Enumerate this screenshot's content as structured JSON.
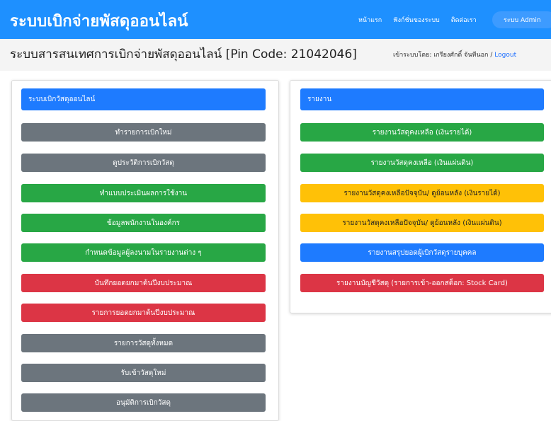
{
  "navbar": {
    "brand": "ระบบเบิกจ่ายพัสดุออนไลน์",
    "links": [
      "หน้าแรก",
      "ฟังก์ชั่นของระบบ",
      "ติดต่อเรา"
    ],
    "admin_button": "ระบบ Admin"
  },
  "subheader": {
    "title": "ระบบสารสนเทศการเบิกจ่ายพัสดุออนไลน์ [Pin Code: 21042046]",
    "login_label": "เข้าระบบโดย: เกรียงศักดิ์ จันทีนอก",
    "separator": "/",
    "logout": "Logout"
  },
  "left_panel": {
    "heading": "ระบบเบิกวัสดุออนไลน์",
    "buttons": [
      {
        "label": "ทำรายการเบิกใหม่",
        "color": "#6c757d"
      },
      {
        "label": "ดูประวัติการเบิกวัสดุ",
        "color": "#6c757d"
      },
      {
        "label": "ทำแบบประเมินผลการใช้งาน",
        "color": "#28a745"
      },
      {
        "label": "ข้อมูลพนักงานในองค์กร",
        "color": "#28a745"
      },
      {
        "label": "กำหนดข้อมูลผู้ลงนามในรายงานต่าง ๆ",
        "color": "#28a745"
      },
      {
        "label": "บันทึกยอดยกมาต้นปีงบประมาณ",
        "color": "#dc3545"
      },
      {
        "label": "รายการยอดยกมาต้นปีงบประมาณ",
        "color": "#dc3545"
      },
      {
        "label": "รายการวัสดุทั้งหมด",
        "color": "#6c757d"
      },
      {
        "label": "รับเข้าวัสดุใหม่",
        "color": "#6c757d"
      },
      {
        "label": "อนุมัติการเบิกวัสดุ",
        "color": "#6c757d"
      }
    ]
  },
  "right_panel": {
    "heading": "รายงาน",
    "buttons": [
      {
        "label": "รายงานวัสดุคงเหลือ (เงินรายได้)",
        "color": "#28a745"
      },
      {
        "label": "รายงานวัสดุคงเหลือ (เงินแผ่นดิน)",
        "color": "#28a745"
      },
      {
        "label": "รายงานวัสดุคงเหลือปัจจุบัน/ ดูย้อนหลัง (เงินรายได้)",
        "color": "#ffc107"
      },
      {
        "label": "รายงานวัสดุคงเหลือปัจจุบัน/ ดูย้อนหลัง (เงินแผ่นดิน)",
        "color": "#ffc107"
      },
      {
        "label": "รายงานสรุปยอดผู้เบิกวัสดุรายบุคคล",
        "color": "#1e7bff"
      },
      {
        "label": "รายงานบัญชีวัสดุ (รายการเข้า-ออกสต็อก: Stock Card)",
        "color": "#dc3545"
      }
    ]
  }
}
